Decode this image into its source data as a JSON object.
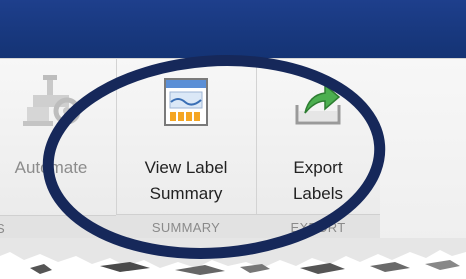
{
  "toolstrip": {
    "automate": {
      "label": "Automate",
      "section": "S"
    },
    "summary": {
      "label_line1": "View Label",
      "label_line2": "Summary",
      "section": "SUMMARY"
    },
    "export": {
      "label_line1": "Export",
      "label_line2": "Labels",
      "section": "EXPORT"
    }
  },
  "colors": {
    "title_band": "#1e3f8c",
    "annotation_ellipse": "#16285a",
    "export_arrow": "#4caf50",
    "summary_icon_accent": "#f5a623"
  },
  "icons": {
    "automate": "gear-robot-icon",
    "summary": "label-summary-icon",
    "export": "export-arrow-icon"
  }
}
